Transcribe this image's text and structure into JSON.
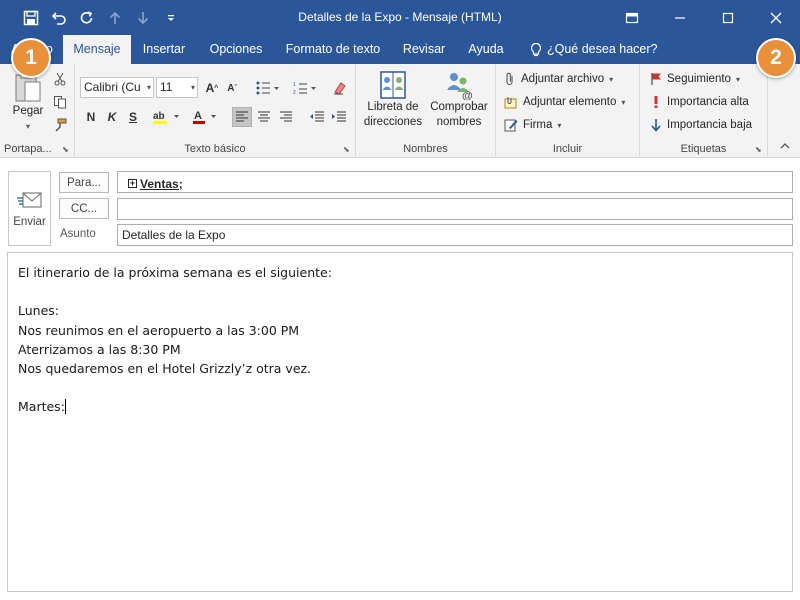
{
  "window": {
    "title": "Detalles de la Expo  -  Mensaje (HTML)",
    "qat_icons": [
      "save-icon",
      "undo-icon",
      "redo-icon",
      "up-arrow-icon",
      "down-arrow-icon",
      "customize-qat-icon"
    ],
    "controls": [
      "ribbon-display-icon",
      "minimize-icon",
      "maximize-icon",
      "close-icon"
    ]
  },
  "tabs": [
    {
      "label": "Archivo"
    },
    {
      "label": "Mensaje",
      "active": true
    },
    {
      "label": "Insertar"
    },
    {
      "label": "Opciones"
    },
    {
      "label": "Formato de texto"
    },
    {
      "label": "Revisar"
    },
    {
      "label": "Ayuda"
    }
  ],
  "tellme": "¿Qué desea hacer?",
  "ribbon": {
    "clipboard": {
      "label": "Portapa...",
      "paste_label": "Pegar"
    },
    "basic_text": {
      "label": "Texto básico",
      "font_name": "Calibri (Cu",
      "font_size": "11",
      "bold": "N",
      "italic": "K",
      "strike": "S"
    },
    "names": {
      "label": "Nombres",
      "address_book": "Libreta de direcciones",
      "check_names": "Comprobar nombres"
    },
    "include": {
      "label": "Incluir",
      "attach_file": "Adjuntar archivo",
      "attach_item": "Adjuntar elemento",
      "signature": "Firma"
    },
    "tags": {
      "label": "Etiquetas",
      "follow_up": "Seguimiento",
      "high_importance": "Importancia alta",
      "low_importance": "Importancia baja"
    }
  },
  "compose": {
    "send_label": "Enviar",
    "to_label": "Para...",
    "cc_label": "CC...",
    "subject_label": "Asunto",
    "to_value": "Ventas;",
    "cc_value": "",
    "subject_value": "Detalles de la Expo",
    "body_lines": [
      "El itinerario de la próxima semana es el siguiente:",
      "",
      "Lunes:",
      "Nos reunimos en el aeropuerto a las 3:00 PM",
      "Aterrizamos a las 8:30 PM",
      "Nos quedaremos en el Hotel Grizzly’z otra vez.",
      "",
      "Martes:"
    ]
  },
  "callouts": [
    "1",
    "2"
  ],
  "colors": {
    "accent": "#2b579a",
    "callout": "#e8913a",
    "flag": "#c0392b",
    "high": "#d13438",
    "low": "#2b579a"
  }
}
